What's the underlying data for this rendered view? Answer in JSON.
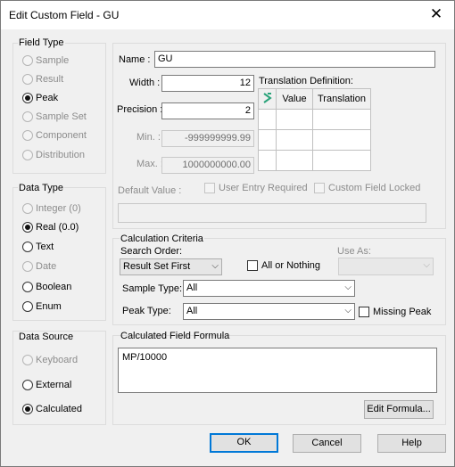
{
  "window": {
    "title": "Edit Custom Field - GU",
    "close_glyph": "✕"
  },
  "field_type": {
    "label": "Field Type",
    "options": [
      {
        "label": "Sample",
        "enabled": false,
        "selected": false
      },
      {
        "label": "Result",
        "enabled": false,
        "selected": false
      },
      {
        "label": "Peak",
        "enabled": true,
        "selected": true
      },
      {
        "label": "Sample Set",
        "enabled": false,
        "selected": false
      },
      {
        "label": "Component",
        "enabled": false,
        "selected": false
      },
      {
        "label": "Distribution",
        "enabled": false,
        "selected": false
      }
    ]
  },
  "data_type": {
    "label": "Data Type",
    "options": [
      {
        "label": "Integer (0)",
        "enabled": false,
        "selected": false
      },
      {
        "label": "Real (0.0)",
        "enabled": true,
        "selected": true
      },
      {
        "label": "Text",
        "enabled": true,
        "selected": false
      },
      {
        "label": "Date",
        "enabled": false,
        "selected": false
      },
      {
        "label": "Boolean",
        "enabled": true,
        "selected": false
      },
      {
        "label": "Enum",
        "enabled": true,
        "selected": false
      }
    ]
  },
  "data_source": {
    "label": "Data Source",
    "options": [
      {
        "label": "Keyboard",
        "enabled": false,
        "selected": false
      },
      {
        "label": "External",
        "enabled": true,
        "selected": false
      },
      {
        "label": "Calculated",
        "enabled": true,
        "selected": true
      }
    ]
  },
  "definition": {
    "name_label": "Name :",
    "name_value": "GU",
    "width_label": "Width :",
    "width_value": "12",
    "precision_label": "Precision :",
    "precision_value": "2",
    "min_label": "Min. :",
    "min_value": "-999999999.99",
    "max_label": "Max. :",
    "max_value": "1000000000.00",
    "default_label": "Default Value :",
    "default_value": "",
    "user_entry_required": "User Entry Required",
    "custom_field_locked": "Custom Field Locked"
  },
  "translation": {
    "label": "Translation Definition:",
    "columns": [
      "Value",
      "Translation"
    ]
  },
  "calculation": {
    "label": "Calculation Criteria",
    "search_order_label": "Search Order:",
    "search_order_value": "Result Set First",
    "all_or_nothing": "All or Nothing",
    "use_as_label": "Use As:",
    "use_as_value": "",
    "sample_type_label": "Sample Type:",
    "sample_type_value": "All",
    "peak_type_label": "Peak Type:",
    "peak_type_value": "All",
    "missing_peak": "Missing Peak"
  },
  "formula": {
    "label": "Calculated Field Formula",
    "value": "MP/10000",
    "edit_button": "Edit Formula..."
  },
  "buttons": {
    "ok": "OK",
    "cancel": "Cancel",
    "help": "Help"
  },
  "icons": {
    "close": "close-icon",
    "row-header": "row-marker-icon"
  },
  "colors": {
    "default_button_border": "#0078d7",
    "row_marker": "#2aa37a"
  }
}
